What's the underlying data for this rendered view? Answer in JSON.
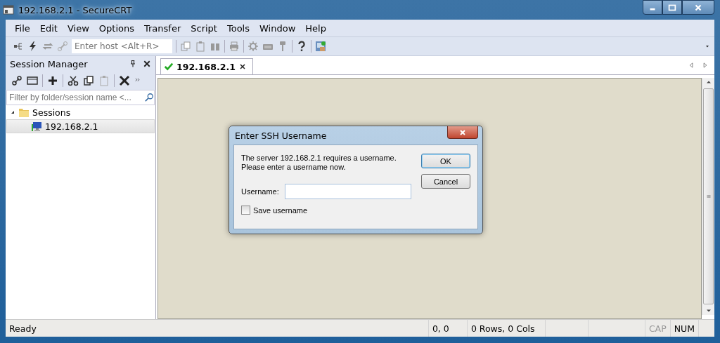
{
  "window": {
    "title": "192.168.2.1 - SecureCRT"
  },
  "menu": [
    "File",
    "Edit",
    "View",
    "Options",
    "Transfer",
    "Script",
    "Tools",
    "Window",
    "Help"
  ],
  "toolbar": {
    "host_field": {
      "placeholder": "Enter host <Alt+R>"
    }
  },
  "session_manager": {
    "title": "Session Manager",
    "filter": {
      "placeholder": "Filter by folder/session name <..."
    },
    "tree": [
      {
        "label": "Sessions",
        "expanded": true,
        "selected": false,
        "children": [
          {
            "label": "192.168.2.1",
            "selected": true
          }
        ]
      }
    ]
  },
  "tabs": [
    {
      "label": "192.168.2.1",
      "connected": true,
      "selected": true
    }
  ],
  "dialog": {
    "title": "Enter SSH Username",
    "message": "The server 192.168.2.1 requires a username.\nPlease enter a username now.",
    "username_label": "Username:",
    "save_label": "Save username",
    "save_checked": false,
    "buttons": [
      "OK",
      "Cancel"
    ]
  },
  "status_bar": {
    "message": "Ready",
    "position": "0, 0",
    "size": "0 Rows, 0 Cols",
    "indicators": [
      {
        "label": "CAP",
        "on": false
      },
      {
        "label": "NUM",
        "on": true
      }
    ]
  }
}
